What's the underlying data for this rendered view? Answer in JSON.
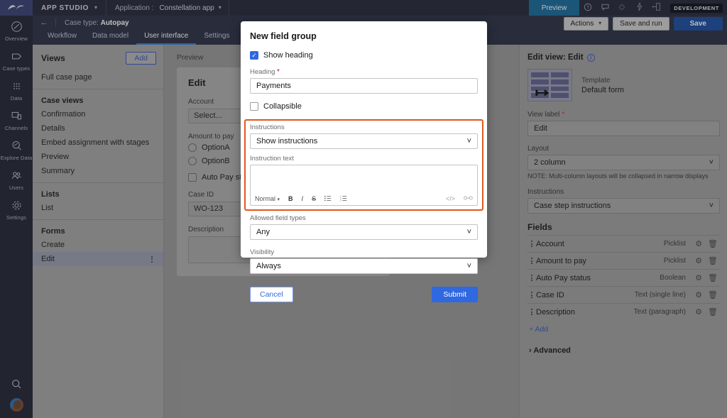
{
  "rail": {
    "logo_icon": "pega-logo-icon",
    "items": [
      {
        "label": "Overview",
        "icon": "overview-icon"
      },
      {
        "label": "Case types",
        "icon": "case-types-icon"
      },
      {
        "label": "Data",
        "icon": "data-grid-icon"
      },
      {
        "label": "Channels",
        "icon": "channels-icon"
      },
      {
        "label": "Explore Data",
        "icon": "explore-data-icon"
      },
      {
        "label": "Users",
        "icon": "users-icon"
      },
      {
        "label": "Settings",
        "icon": "settings-gear-icon"
      }
    ],
    "search_icon": "search-icon",
    "avatar": "user-avatar"
  },
  "topbar": {
    "studio": "APP STUDIO",
    "application_label": "Application :",
    "application_name": "Constellation app",
    "preview": "Preview",
    "icons": [
      "help-icon",
      "chat-icon",
      "sparkle-icon",
      "bolt-icon",
      "branch-icon"
    ],
    "environment_badge": "DEVELOPMENT"
  },
  "actionbar": {
    "actions": "Actions",
    "save_and_run": "Save and run",
    "save": "Save"
  },
  "casebar": {
    "back_icon": "back-arrow-icon",
    "prefix": "Case type:",
    "name": "Autopay"
  },
  "tabs": [
    {
      "label": "Workflow",
      "active": false
    },
    {
      "label": "Data model",
      "active": false
    },
    {
      "label": "User interface",
      "active": true
    },
    {
      "label": "Settings",
      "active": false
    }
  ],
  "sidebar": {
    "views_title": "Views",
    "add_button": "Add",
    "full_case_page": "Full case page",
    "case_views_title": "Case views",
    "case_views": [
      "Confirmation",
      "Details",
      "Embed assignment with stages",
      "Preview",
      "Summary"
    ],
    "lists_title": "Lists",
    "lists": [
      "List"
    ],
    "forms_title": "Forms",
    "forms": [
      "Create",
      "Edit"
    ],
    "selected_form": "Edit"
  },
  "preview": {
    "label": "Preview",
    "form_title": "Edit",
    "account_label": "Account",
    "account_value": "Select...",
    "amount_label": "Amount to pay",
    "option_a": "OptionA",
    "option_b": "OptionB",
    "auto_pay_label": "Auto Pay status",
    "case_id_label": "Case ID",
    "case_id_value": "WO-123",
    "description_label": "Description"
  },
  "modal": {
    "title": "New field group",
    "show_heading_label": "Show heading",
    "show_heading_checked": true,
    "heading_label": "Heading",
    "heading_required": "*",
    "heading_value": "Payments",
    "collapsible_label": "Collapsible",
    "collapsible_checked": false,
    "instructions_label": "Instructions",
    "instructions_value": "Show instructions",
    "instruction_text_label": "Instruction text",
    "instruction_text_value": "",
    "rte_toolbar": {
      "style": "Normal",
      "bold": "B",
      "italic": "I",
      "strikethrough": "S",
      "bullet_list": "bullet-list-icon",
      "numbered_list": "numbered-list-icon",
      "code": "</>",
      "link": "link-icon"
    },
    "allowed_field_types_label": "Allowed field types",
    "allowed_field_types_value": "Any",
    "visibility_label": "Visibility",
    "visibility_value": "Always",
    "cancel": "Cancel",
    "submit": "Submit",
    "highlight_color": "#e2571e"
  },
  "rightpanel": {
    "title": "Edit view: Edit",
    "info_icon": "info-icon",
    "template_key": "Template",
    "template_value": "Default form",
    "view_label_label": "View label",
    "view_label_required": "*",
    "view_label_value": "Edit",
    "layout_label": "Layout",
    "layout_value": "2 column",
    "layout_note": "NOTE: Multi-column layouts will be collapsed in narrow displays",
    "instructions_label": "Instructions",
    "instructions_value": "Case step instructions",
    "fields_title": "Fields",
    "fields": [
      {
        "name": "Account",
        "type": "Picklist"
      },
      {
        "name": "Amount to pay",
        "type": "Picklist"
      },
      {
        "name": "Auto Pay status",
        "type": "Boolean"
      },
      {
        "name": "Case ID",
        "type": "Text (single line)"
      },
      {
        "name": "Description",
        "type": "Text (paragraph)"
      }
    ],
    "add_field": "Add",
    "advanced": "Advanced"
  },
  "colors": {
    "accent_blue": "#2f68e0",
    "topbar_bg": "#272b3c",
    "rail_bg": "#242838",
    "highlight_orange": "#e2571e",
    "preview_btn": "#1b6b9c"
  }
}
